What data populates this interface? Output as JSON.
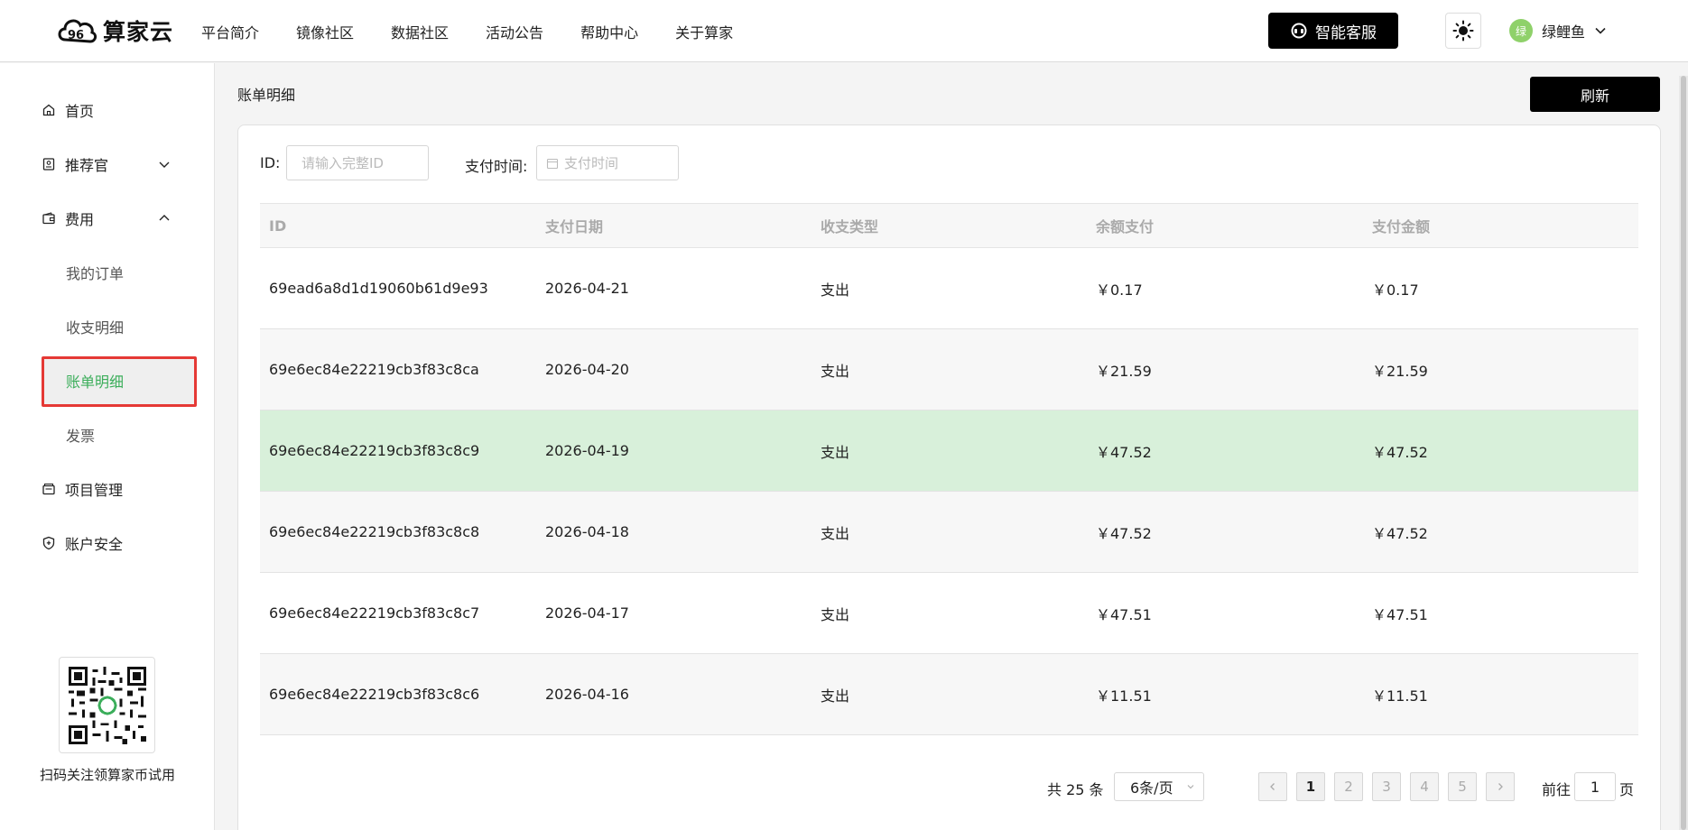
{
  "app": {
    "brand": "算家云"
  },
  "nav": [
    "平台简介",
    "镜像社区",
    "数据社区",
    "活动公告",
    "帮助中心",
    "关于算家"
  ],
  "header": {
    "support_button": "智能客服",
    "avatar_text": "绿",
    "user_name": "绿鲤鱼"
  },
  "sidebar": {
    "items": [
      {
        "label": "首页",
        "icon": "home-icon"
      },
      {
        "label": "推荐官",
        "icon": "badge-icon",
        "expand": "chevron-down-icon"
      },
      {
        "label": "费用",
        "icon": "wallet-icon",
        "expand": "chevron-up-icon"
      },
      {
        "label": "项目管理",
        "icon": "folder-icon"
      },
      {
        "label": "账户安全",
        "icon": "shield-icon"
      }
    ],
    "sub_items": [
      "我的订单",
      "收支明细",
      "账单明细",
      "发票"
    ],
    "active": "账单明细",
    "qr_caption": "扫码关注领算家币试用"
  },
  "main": {
    "title": "账单明细",
    "refresh_label": "刷新",
    "filters": {
      "id_label": "ID:",
      "id_placeholder": "请输入完整ID",
      "time_label": "支付时间:",
      "time_placeholder": "支付时间"
    },
    "table": {
      "headers": [
        "ID",
        "支付日期",
        "收支类型",
        "余额支付",
        "支付金额"
      ],
      "rows": [
        [
          "69ead6a8d1d19060b61d9e93",
          "2026-04-21",
          "支出",
          "￥0.17",
          "￥0.17"
        ],
        [
          "69e6ec84e22219cb3f83c8ca",
          "2026-04-20",
          "支出",
          "￥21.59",
          "￥21.59"
        ],
        [
          "69e6ec84e22219cb3f83c8c9",
          "2026-04-19",
          "支出",
          "￥47.52",
          "￥47.52"
        ],
        [
          "69e6ec84e22219cb3f83c8c8",
          "2026-04-18",
          "支出",
          "￥47.52",
          "￥47.52"
        ],
        [
          "69e6ec84e22219cb3f83c8c7",
          "2026-04-17",
          "支出",
          "￥47.51",
          "￥47.51"
        ],
        [
          "69e6ec84e22219cb3f83c8c6",
          "2026-04-16",
          "支出",
          "￥11.51",
          "￥11.51"
        ]
      ]
    },
    "pagination": {
      "total": "共 25 条",
      "page_size": "6条/页",
      "pages": [
        "1",
        "2",
        "3",
        "4",
        "5"
      ],
      "current": "1",
      "goto_label": "前往",
      "goto_value": "1",
      "page_unit": "页"
    }
  },
  "colors": {
    "accent": "#3cae5b",
    "highlight_row": "#d8f0da",
    "active_box": "#e53935",
    "primary": "#000000"
  }
}
